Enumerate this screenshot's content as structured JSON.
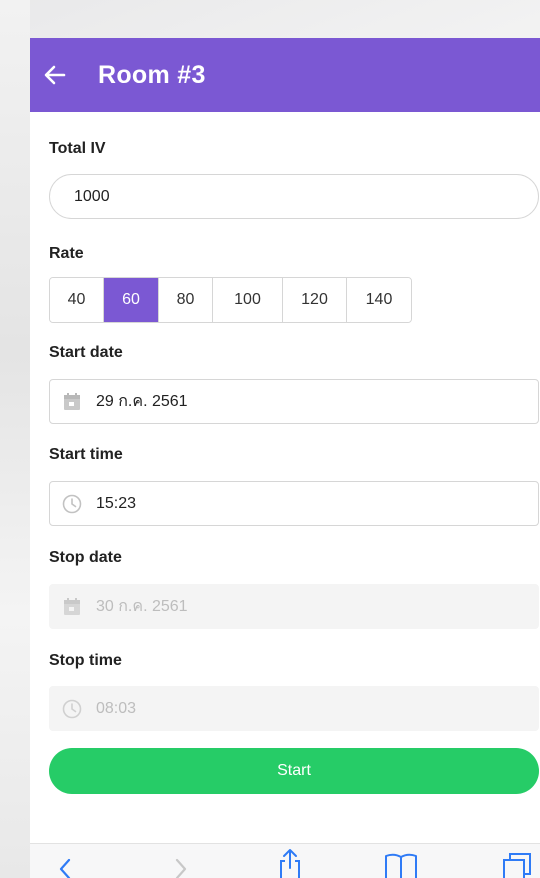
{
  "header": {
    "title": "Room #3",
    "back_icon": "arrow-left-icon",
    "color": "#7b58d3"
  },
  "form": {
    "total_iv": {
      "label": "Total IV",
      "value": "1000"
    },
    "rate": {
      "label": "Rate",
      "options": [
        "40",
        "60",
        "80",
        "100",
        "120",
        "140"
      ],
      "selected": "60"
    },
    "start_date": {
      "label": "Start date",
      "value": "29 ก.ค. 2561",
      "icon": "calendar-icon"
    },
    "start_time": {
      "label": "Start time",
      "value": "15:23",
      "icon": "clock-icon"
    },
    "stop_date": {
      "label": "Stop date",
      "value": "30 ก.ค. 2561",
      "icon": "calendar-icon",
      "disabled": true
    },
    "stop_time": {
      "label": "Stop time",
      "value": "08:03",
      "icon": "clock-icon",
      "disabled": true
    }
  },
  "start_button": {
    "label": "Start",
    "color": "#26cc67"
  },
  "browser_toolbar": {
    "icons": [
      "chevron-left-icon",
      "chevron-right-icon",
      "share-icon",
      "bookmarks-icon",
      "tabs-icon"
    ],
    "accent": "#2f7bf6"
  }
}
